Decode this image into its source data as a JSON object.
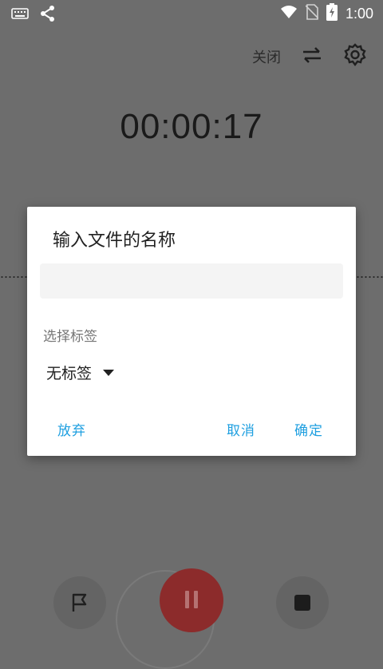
{
  "status_bar": {
    "time": "1:00",
    "icons": [
      "keyboard-icon",
      "share-icon",
      "wifi-icon",
      "no-sim-icon",
      "battery-charging-icon"
    ]
  },
  "app": {
    "close_label": "关闭",
    "timer": "00:00:17",
    "icons": [
      "swap-icon",
      "settings-gear-icon",
      "flag-icon",
      "pause-icon",
      "stop-icon"
    ]
  },
  "dialog": {
    "title": "输入文件的名称",
    "name_input_value": "",
    "tag_section_label": "选择标签",
    "tag_selected": "无标签",
    "buttons": {
      "discard": "放弃",
      "cancel": "取消",
      "confirm": "确定"
    }
  },
  "colors": {
    "accent": "#1e9fe0",
    "record_button": "#c23b3b",
    "scrim_background": "#6d6d6d"
  }
}
